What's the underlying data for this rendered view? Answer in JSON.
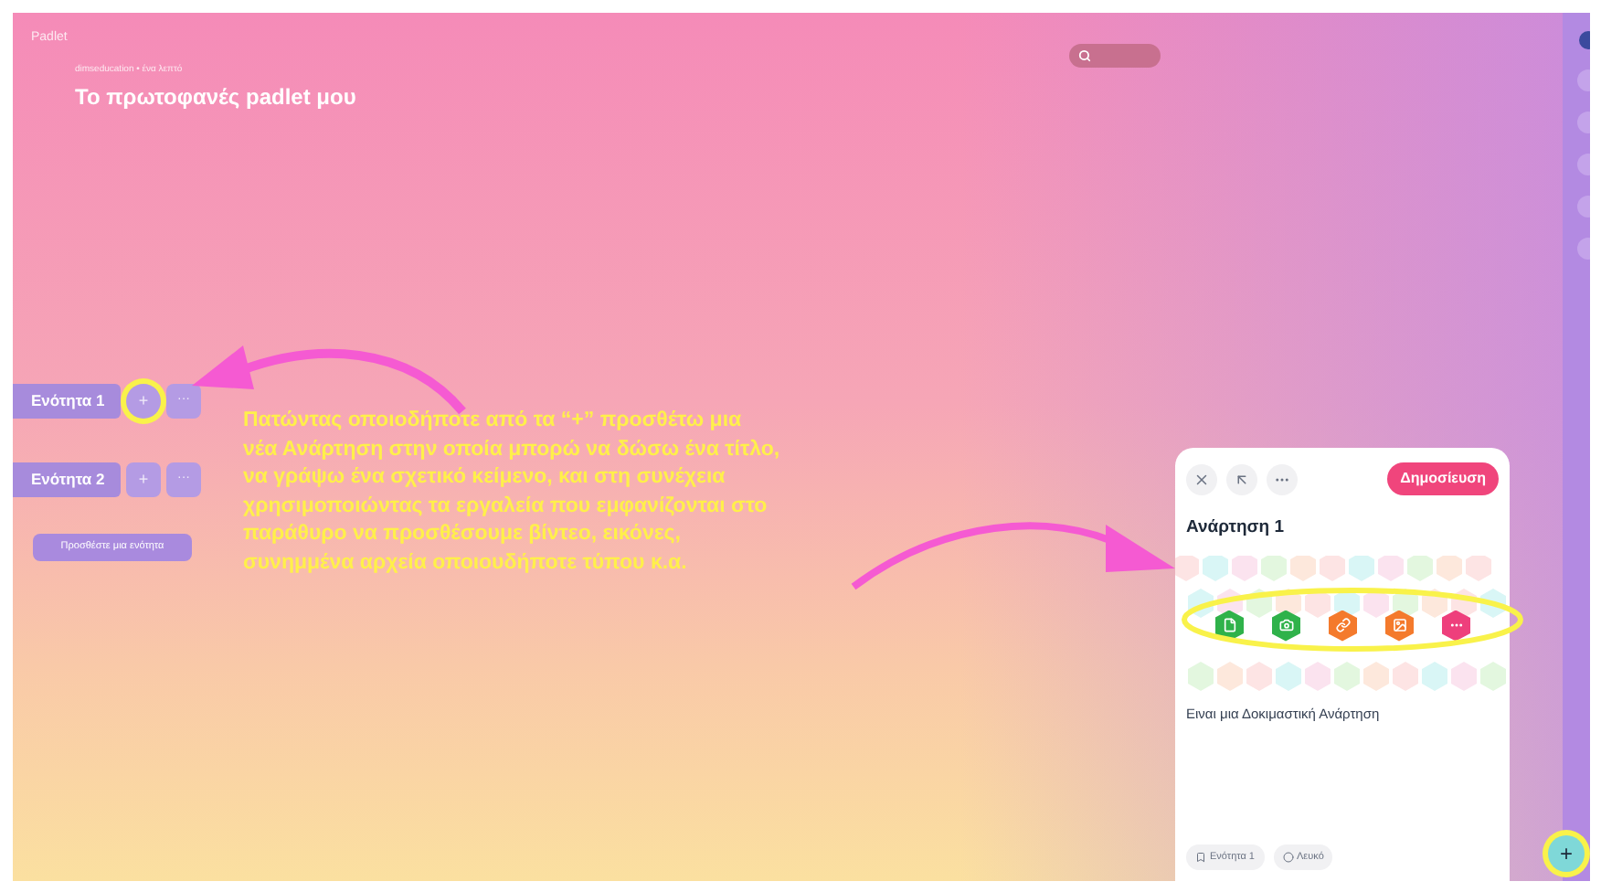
{
  "app": {
    "name": "Padlet"
  },
  "header": {
    "breadcrumb": "dimseducation • ένα λεπτό",
    "title": "Το πρωτοφανές padlet μου"
  },
  "sections": [
    {
      "title": "Ενότητα 1",
      "add_label": "+",
      "more_label": "···",
      "highlighted": true
    },
    {
      "title": "Ενότητα 2",
      "add_label": "+",
      "more_label": "···",
      "highlighted": false
    }
  ],
  "add_section_button": "Προσθέστε μια ενότητα",
  "annotation": {
    "text": "Πατώντας οποιοδήποτε από τα “+” προσθέτω μια\nνέα Ανάρτηση στην οποία μπορώ να δώσω ένα τίτλο,\nνα γράψω ένα σχετικό κείμενο, και στη συνέχεια\nχρησιμοποιώντας τα εργαλεία που εμφανίζονται στο\nπαράθυρο να προσθέσουμε βίντεο, εικόνες,\nσυνημμένα αρχεία οποιουδήποτε τύπου κ.α."
  },
  "post_editor": {
    "publish_button": "Δημοσίευση",
    "title": "Ανάρτηση 1",
    "tools": [
      {
        "kind": "file",
        "color": "#2fb24a"
      },
      {
        "kind": "camera",
        "color": "#2fb24a"
      },
      {
        "kind": "link",
        "color": "#f47a2c"
      },
      {
        "kind": "image",
        "color": "#f47a2c"
      },
      {
        "kind": "more",
        "color": "#ee3f7c"
      }
    ],
    "body": "Ειναι μια Δοκιμαστική Ανάρτηση",
    "section_chip": "Ενότητα 1",
    "color_chip": "Λευκό"
  },
  "fab": {
    "label": "+"
  }
}
